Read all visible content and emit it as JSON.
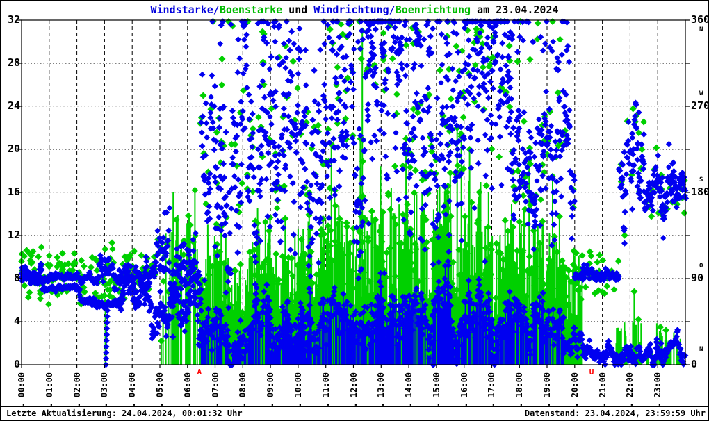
{
  "window": {
    "kind": "weather-station wind chart",
    "date_shown": "23.04.2024"
  },
  "title": {
    "parts": [
      {
        "text": "Windstarke/",
        "color": "#0000dd"
      },
      {
        "text": "Boenstarke",
        "color": "#00bb00"
      },
      {
        "text": " und ",
        "color": "#000000"
      },
      {
        "text": "Windrichtung/",
        "color": "#0000dd"
      },
      {
        "text": "Boenrichtung",
        "color": "#00bb00"
      },
      {
        "text": " am 23.04.2024",
        "color": "#000000"
      }
    ]
  },
  "footer": {
    "left_text": "Letzte Aktualisierung: 24.04.2024, 00:01:32 Uhr",
    "right_text": "Datenstand: 23.04.2024, 23:59:59 Uhr"
  },
  "colors": {
    "wind_blue": "#0000f0",
    "gust_green": "#00d000",
    "grid_black": "#000000",
    "grid_gray": "#b0b0b0",
    "sun_marker_red": "#ff0000",
    "background": "#ffffff"
  },
  "axes": {
    "left": {
      "label_values": [
        32,
        28,
        24,
        20,
        16,
        12,
        8,
        4,
        0
      ],
      "min": 0,
      "max": 32,
      "step": 4
    },
    "right": {
      "min": 0,
      "max": 360,
      "step": 90,
      "ticks": [
        {
          "value": 360,
          "number": "360",
          "letter": "N",
          "letter_pos": "below"
        },
        {
          "value": 270,
          "number": "270",
          "letter": "W",
          "letter_pos": "above"
        },
        {
          "value": 180,
          "number": "180",
          "letter": "S",
          "letter_pos": "above"
        },
        {
          "value": 90,
          "number": "90",
          "letter": "O",
          "letter_pos": "above"
        },
        {
          "value": 0,
          "number": "0",
          "letter": "N",
          "letter_pos": "above"
        }
      ]
    },
    "x": {
      "tick_labels": [
        "23. 00:00",
        "23. 01:00",
        "23. 02:00",
        "23. 03:00",
        "23. 04:00",
        "23. 05:00",
        "23. 06:00",
        "23. 07:00",
        "23. 08:00",
        "23. 09:00",
        "23. 10:00",
        "23. 11:00",
        "23. 12:00",
        "23. 13:00",
        "23. 14:00",
        "23. 15:00",
        "23. 16:00",
        "23. 17:00",
        "23. 18:00",
        "23. 19:00",
        "23. 20:00",
        "23. 21:00",
        "23. 22:00",
        "23. 23:00"
      ],
      "hours_span": 24,
      "gray_direction_gridlines_at": [
        24,
        16
      ]
    }
  },
  "sun_markers": [
    {
      "label": "A",
      "hour": 6.42,
      "meaning": "Sonnenaufgang"
    },
    {
      "label": "U",
      "hour": 20.6,
      "meaning": "Sonnenuntergang"
    }
  ],
  "chart_data": {
    "type": "scatter",
    "title": "Windstarke/Boenstarke und Windrichtung/Boenrichtung am 23.04.2024",
    "x_range_hours": [
      0,
      24
    ],
    "y_left_range": [
      0,
      32
    ],
    "y_right_range_deg": [
      0,
      360
    ],
    "series": [
      {
        "name": "Windstarke",
        "style": "blue diamonds + blue impulse lines, left axis"
      },
      {
        "name": "Boenstarke",
        "style": "green impulse lines + green diamonds, left axis"
      },
      {
        "name": "Windrichtung",
        "style": "blue diamonds, right axis"
      },
      {
        "name": "Boenrichtung",
        "style": "green diamonds, right axis"
      }
    ],
    "speed_segments": [
      {
        "t0": 0.0,
        "t1": 0.75,
        "mean": 8.9,
        "jit": 0.9
      },
      {
        "t0": 0.75,
        "t1": 2.1,
        "mean": 7.0,
        "jit": 0.35
      },
      {
        "t0": 2.1,
        "t1": 2.65,
        "mean": 6.3,
        "jit": 0.5
      },
      {
        "t0": 2.65,
        "t1": 3.6,
        "mean": 5.6,
        "jit": 0.5
      },
      {
        "t0": 3.6,
        "t1": 4.7,
        "mean": 6.3,
        "jit": 2.2
      },
      {
        "t0": 4.7,
        "t1": 6.5,
        "mean": 4.4,
        "jit": 2.2
      },
      {
        "t0": 6.5,
        "t1": 9.0,
        "mean": 3.6,
        "jit": 2.6,
        "imp": true
      },
      {
        "t0": 9.0,
        "t1": 12.5,
        "mean": 4.2,
        "jit": 3.0,
        "imp": true
      },
      {
        "t0": 12.5,
        "t1": 17.0,
        "mean": 4.6,
        "jit": 3.2,
        "imp": true
      },
      {
        "t0": 17.0,
        "t1": 19.6,
        "mean": 3.6,
        "jit": 2.7,
        "imp": true
      },
      {
        "t0": 19.6,
        "t1": 20.3,
        "mean": 1.8,
        "jit": 1.4
      },
      {
        "t0": 20.3,
        "t1": 24.0,
        "mean": 1.2,
        "jit": 1.1
      }
    ],
    "direction_segments": [
      {
        "t0": 0.0,
        "t1": 2.8,
        "mean": 91,
        "jit": 5
      },
      {
        "t0": 2.8,
        "t1": 4.8,
        "mean": 96,
        "jit": 16
      },
      {
        "t0": 4.8,
        "t1": 6.5,
        "mean": 110,
        "jit": 38
      },
      {
        "t0": 6.5,
        "t1": 9.5,
        "mean": 225,
        "jit": 115
      },
      {
        "t0": 9.5,
        "t1": 17.5,
        "mean": 255,
        "jit": 130
      },
      {
        "t0": 17.5,
        "t1": 20.0,
        "mean": 235,
        "jit": 78
      },
      {
        "t0": 20.0,
        "t1": 21.6,
        "mean": 93,
        "jit": 6
      },
      {
        "t0": 21.6,
        "t1": 22.5,
        "mean": 200,
        "jit": 48
      },
      {
        "t0": 22.5,
        "t1": 24.0,
        "mean": 188,
        "jit": 28
      }
    ],
    "gust_impulse_band": {
      "t0": 5.0,
      "t1": 20.3,
      "sparse_t0": 21.5,
      "sparse_t1": 23.9
    },
    "gust_spikes": [
      [
        3.03,
        5.8
      ],
      [
        5.05,
        2.2
      ],
      [
        5.3,
        6.8
      ],
      [
        5.55,
        7.2
      ],
      [
        10.4,
        16.0
      ],
      [
        11.2,
        20.5
      ],
      [
        12.25,
        21.0
      ],
      [
        12.32,
        31.0
      ],
      [
        13.9,
        21.0
      ],
      [
        15.75,
        22.0
      ],
      [
        15.9,
        21.2
      ],
      [
        16.2,
        20.0
      ],
      [
        18.35,
        19.0
      ],
      [
        19.2,
        17.5
      ],
      [
        22.15,
        6.8
      ],
      [
        22.3,
        4.2
      ],
      [
        23.1,
        3.5
      ],
      [
        23.3,
        3.2
      ]
    ],
    "calm_dip": {
      "t": 3.05,
      "from": 0,
      "to": 5.6
    }
  }
}
